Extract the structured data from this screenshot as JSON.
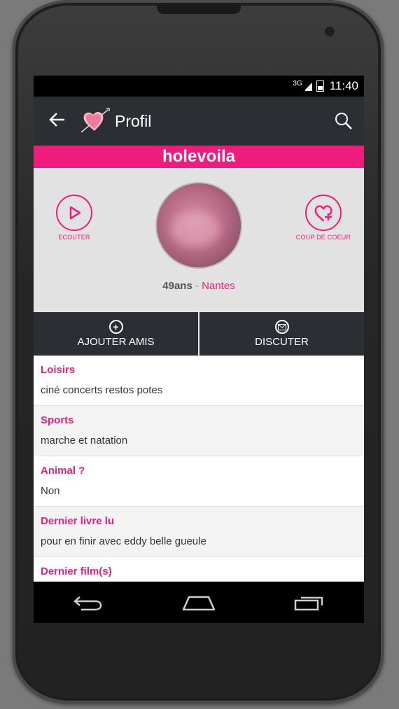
{
  "status": {
    "network": "3G",
    "time": "11:40"
  },
  "appbar": {
    "title": "Profil"
  },
  "profile": {
    "username": "holevoila",
    "listen_label": "ECOUTER",
    "crush_label": "COUP DE COEUR",
    "age": "49ans",
    "separator": " - ",
    "city": "Nantes"
  },
  "actions": {
    "add_friends": "AJOUTER AMIS",
    "chat": "DISCUTER"
  },
  "info": [
    {
      "label": "Loisirs",
      "value": "ciné concerts restos potes"
    },
    {
      "label": "Sports",
      "value": "marche et natation"
    },
    {
      "label": "Animal ?",
      "value": "Non"
    },
    {
      "label": "Dernier livre lu",
      "value": "pour en finir avec eddy belle gueule"
    },
    {
      "label": "Dernier film(s)",
      "value": ""
    }
  ],
  "colors": {
    "accent": "#f01c7d",
    "bar": "#2b2e33"
  }
}
